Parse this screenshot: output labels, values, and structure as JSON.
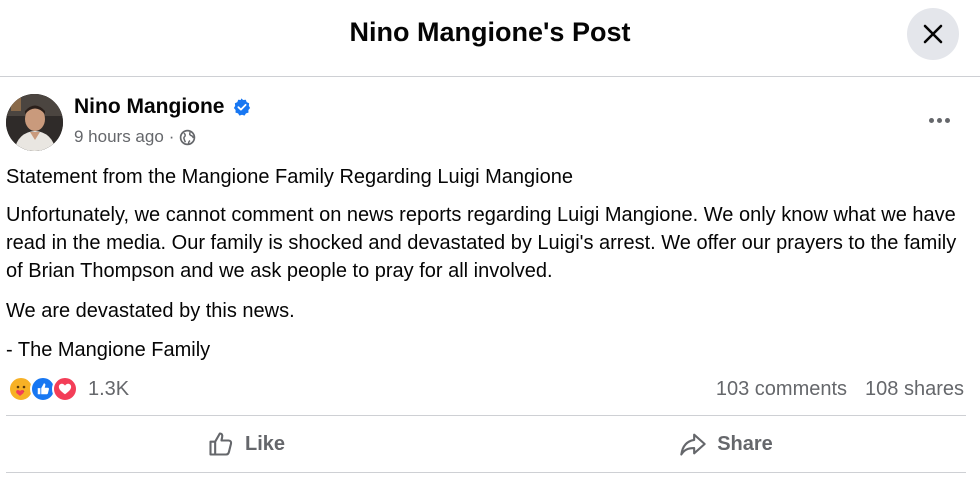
{
  "header": {
    "title": "Nino Mangione's Post",
    "close_icon": "close-icon"
  },
  "post": {
    "author": "Nino Mangione",
    "verified": true,
    "timestamp": "9 hours ago",
    "meta_separator": "·",
    "privacy_icon": "globe-icon",
    "title_line": "Statement from the Mangione Family Regarding Luigi Mangione",
    "body": "Unfortunately, we cannot comment on news reports regarding Luigi Mangione.  We only know what we have read in the media.  Our family is shocked and devastated by Luigi's arrest.  We offer our prayers to the family of Brian Thompson and we ask people to pray for all involved.",
    "line_devastated": "We are devastated by this news.",
    "signature": "- The Mangione Family"
  },
  "stats": {
    "reaction_icons": [
      "care",
      "like",
      "love"
    ],
    "reaction_count": "1.3K",
    "comments": "103 comments",
    "shares": "108 shares"
  },
  "actions": {
    "like_label": "Like",
    "share_label": "Share"
  },
  "colors": {
    "brand_blue": "#1877f2",
    "love_red": "#f33e58",
    "care_yellow": "#f7b125",
    "secondary_text": "#65676b",
    "divider": "#ced0d4"
  }
}
